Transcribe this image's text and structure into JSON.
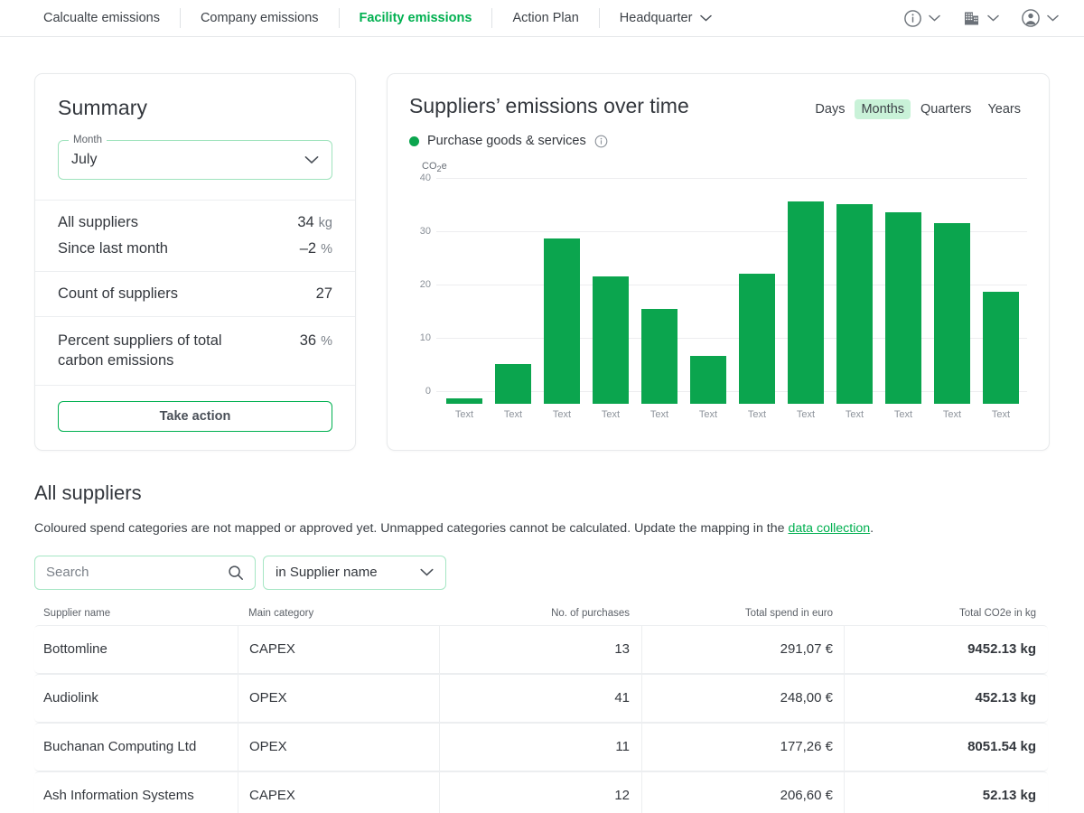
{
  "nav": {
    "items": [
      {
        "label": "Calcualte emissions",
        "active": false
      },
      {
        "label": "Company emissions",
        "active": false
      },
      {
        "label": "Facility emissions",
        "active": true
      },
      {
        "label": "Action Plan",
        "active": false
      }
    ],
    "facility_selector": "Headquarter",
    "icons": [
      "info-icon",
      "building-icon",
      "account-icon"
    ]
  },
  "summary": {
    "title": "Summary",
    "month_label": "Month",
    "month_value": "July",
    "rows": [
      {
        "label": "All suppliers",
        "value": "34",
        "unit": "kg"
      },
      {
        "label": "Since last month",
        "value": "–2",
        "unit": "%"
      },
      {
        "label": "Count of suppliers",
        "value": "27",
        "unit": ""
      },
      {
        "label": "Percent suppliers of total carbon emissions",
        "value": "36",
        "unit": "%"
      }
    ],
    "take_action_label": "Take action"
  },
  "chart": {
    "title": "Suppliers’ emissions over time",
    "range_tabs": [
      {
        "label": "Days",
        "active": false
      },
      {
        "label": "Months",
        "active": true
      },
      {
        "label": "Quarters",
        "active": false
      },
      {
        "label": "Years",
        "active": false
      }
    ],
    "legend_label": "Purchase goods & services",
    "legend_info_icon": "info-icon"
  },
  "chart_data": {
    "type": "bar",
    "title": "Suppliers’ emissions over time",
    "xlabel": "",
    "ylabel": "CO₂e",
    "ylim": [
      0,
      40
    ],
    "yticks": [
      0,
      10,
      20,
      30,
      40
    ],
    "grid": true,
    "legend": [
      "Purchase goods & services"
    ],
    "legend_position": "top-left",
    "categories": [
      "Text",
      "Text",
      "Text",
      "Text",
      "Text",
      "Text",
      "Text",
      "Text",
      "Text",
      "Text",
      "Text",
      "Text"
    ],
    "values": [
      1,
      7.5,
      31,
      24,
      17.8,
      9,
      24.5,
      38,
      37.5,
      36,
      34,
      21
    ],
    "color": "#0ba54e"
  },
  "suppliers": {
    "title": "All suppliers",
    "note_prefix": "Coloured spend categories are not mapped or approved yet. Unmapped categories cannot be calculated. Update the mapping in the ",
    "note_link": "data collection",
    "note_suffix": ".",
    "search_placeholder": "Search",
    "search_value": "",
    "search_icon": "search-icon",
    "scope_value": "in Supplier name",
    "columns": [
      "Supplier name",
      "Main category",
      "No. of purchases",
      "Total spend in euro",
      "Total CO2e in kg"
    ],
    "rows": [
      {
        "name": "Bottomline",
        "category": "CAPEX",
        "purchases": "13",
        "spend": "291,07 €",
        "co2e": "9452.13 kg"
      },
      {
        "name": "Audiolink",
        "category": "OPEX",
        "purchases": "41",
        "spend": "248,00 €",
        "co2e": "452.13 kg"
      },
      {
        "name": "Buchanan Computing Ltd",
        "category": "OPEX",
        "purchases": "11",
        "spend": "177,26 €",
        "co2e": "8051.54 kg"
      },
      {
        "name": "Ash Information Systems",
        "category": "CAPEX",
        "purchases": "12",
        "spend": "206,60 €",
        "co2e": "52.13 kg"
      }
    ]
  },
  "colors": {
    "brand_green": "#00b050",
    "bar_green": "#0ba54e",
    "tab_highlight": "#c9f2d8",
    "border_green": "#a6e6c4"
  }
}
